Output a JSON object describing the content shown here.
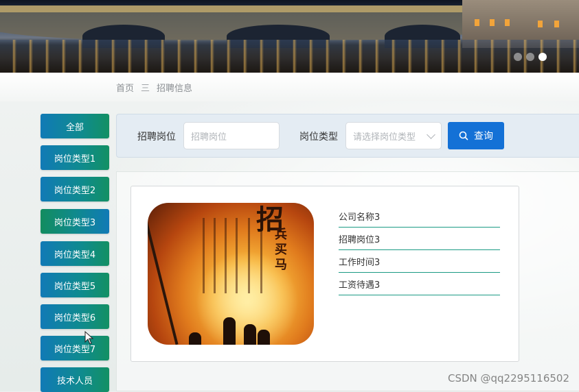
{
  "carousel": {
    "dot_count": 3,
    "active_index": 2
  },
  "breadcrumb": {
    "home": "首页",
    "separator": "三",
    "current": "招聘信息"
  },
  "sidebar": {
    "items": [
      {
        "label": "全部"
      },
      {
        "label": "岗位类型1"
      },
      {
        "label": "岗位类型2"
      },
      {
        "label": "岗位类型3"
      },
      {
        "label": "岗位类型4"
      },
      {
        "label": "岗位类型5"
      },
      {
        "label": "岗位类型6"
      },
      {
        "label": "岗位类型7"
      },
      {
        "label": "技术人员"
      }
    ]
  },
  "filter": {
    "position_label": "招聘岗位",
    "position_placeholder": "招聘岗位",
    "type_label": "岗位类型",
    "type_placeholder": "请选择岗位类型",
    "query_label": "查询"
  },
  "card": {
    "poster_title": "招",
    "poster_subtitle": "兵买马",
    "fields": [
      {
        "text": "公司名称3"
      },
      {
        "text": "招聘岗位3"
      },
      {
        "text": "工作时间3"
      },
      {
        "text": "工资待遇3"
      }
    ]
  },
  "watermark": "CSDN @qq2295116502",
  "colors": {
    "primary": "#1471d6",
    "sidebar_blue": "#117ab6",
    "sidebar_green": "#139063",
    "underline": "#199a83"
  }
}
